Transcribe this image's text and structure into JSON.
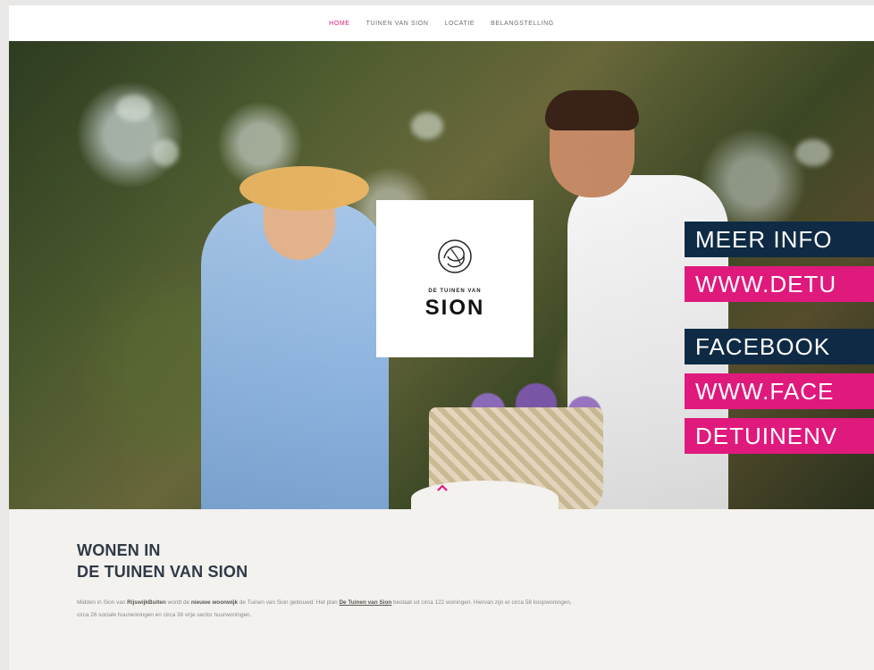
{
  "nav": {
    "items": [
      {
        "label": "HOME",
        "active": true
      },
      {
        "label": "TUINEN VAN SION",
        "active": false
      },
      {
        "label": "LOCATIE",
        "active": false
      },
      {
        "label": "BELANGSTELLING",
        "active": false
      }
    ]
  },
  "logo": {
    "line1": "DE TUINEN VAN",
    "line2": "SION",
    "emblem_icon": "sion-emblem-icon"
  },
  "content": {
    "heading_line1": "WONEN IN",
    "heading_line2": "DE TUINEN VAN SION",
    "para_part1": "Midden in Sion van ",
    "para_bold1": "RijswijkBuiten",
    "para_part2": " wordt de ",
    "para_bold2": "nieuwe woonwijk",
    "para_part3": " de Tuinen van Sion gebouwd. Het plan ",
    "para_link": "De Tuinen van Sion",
    "para_part4": " bestaat uit circa 122 woningen. Hiervan zijn er circa 58 koopwoningen, circa 26 sociale huurwoningen en circa 38 vrije sector huurwoningen."
  },
  "promo": {
    "line1": "MEER INFO",
    "line2": "WWW.DETU",
    "line3": "FACEBOOK",
    "line4": "WWW.FACE",
    "line5": "DETUINENV"
  },
  "scroll_icon": "chevron-up-icon",
  "colors": {
    "accent_pink": "#e0197d",
    "navy": "#0e2a44",
    "heading": "#2f3a46"
  }
}
